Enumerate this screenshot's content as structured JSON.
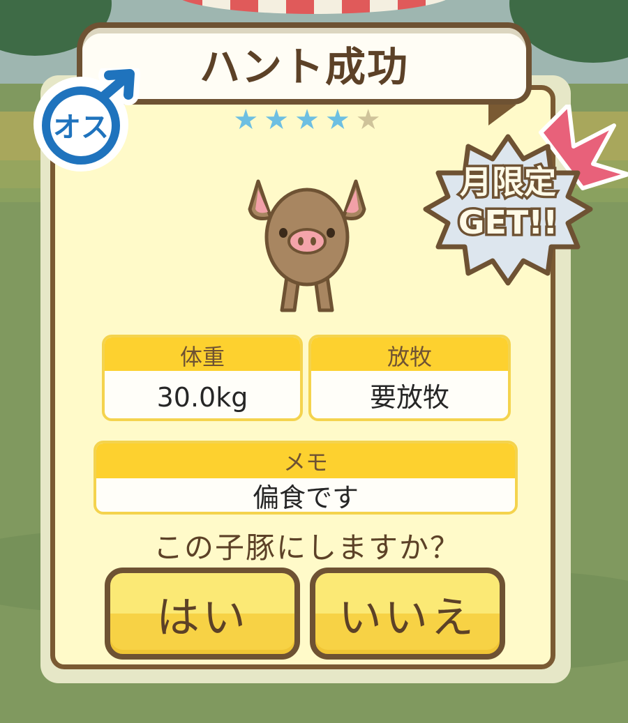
{
  "dialog": {
    "title": "ハント成功",
    "gender_label": "オス",
    "gender_icon": "male-symbol-icon",
    "rating": {
      "filled": 4,
      "total": 5
    },
    "limited_badge": {
      "line1": "月限定",
      "line2": "GET!!"
    }
  },
  "stats": {
    "weight": {
      "label": "体重",
      "value": "30.0kg"
    },
    "grazing": {
      "label": "放牧",
      "value": "要放牧"
    },
    "memo": {
      "label": "メモ",
      "value": "偏食です"
    }
  },
  "prompt": {
    "question": "この子豚にしますか？",
    "yes_label": "はい",
    "no_label": "いいえ"
  },
  "colors": {
    "frame": "#7a5a33",
    "card": "#fffac9",
    "header_yellow": "#fdd12f",
    "button_yellow": "#f7d245",
    "star_on": "#6dbfe2",
    "star_off": "#cfc39a",
    "badge_pink": "#e8617a",
    "gender_blue": "#1f73bd"
  }
}
